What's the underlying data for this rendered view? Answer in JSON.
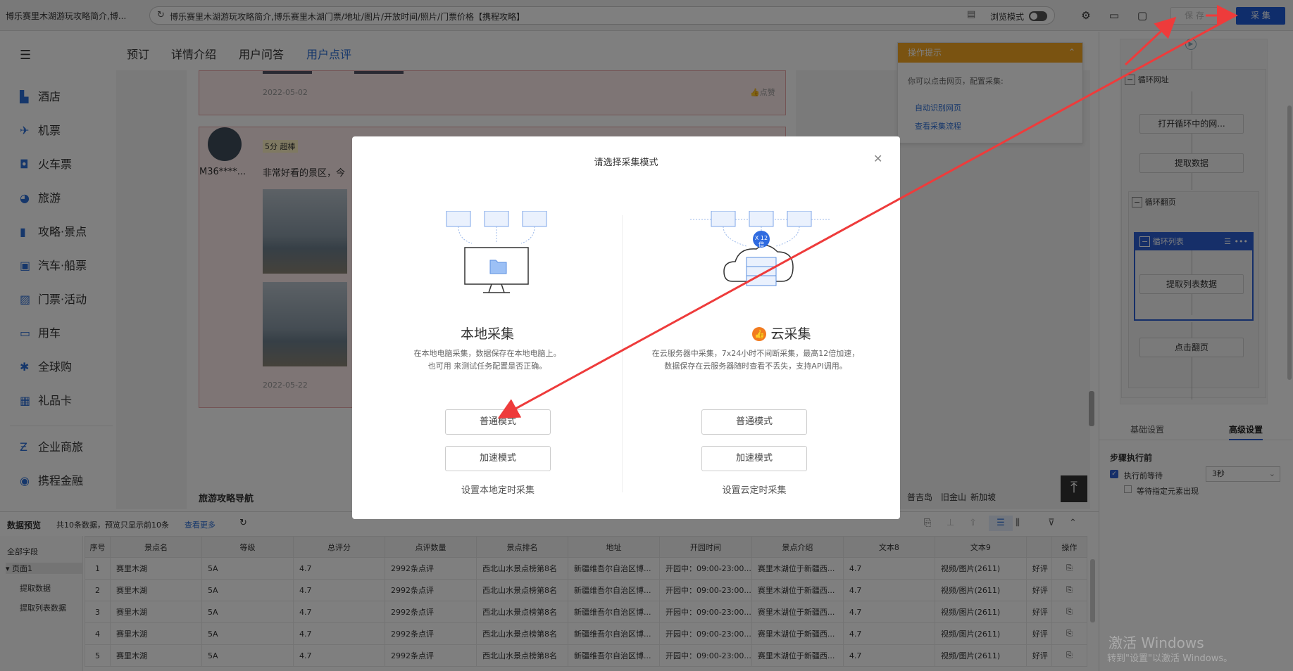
{
  "browser": {
    "tab_title": "博乐赛里木湖游玩攻略简介,博...",
    "url": "博乐赛里木湖游玩攻略简介,博乐赛里木湖门票/地址/图片/开放时间/照片/门票价格【携程攻略】",
    "browse_mode_label": "浏览模式",
    "save_label": "保 存",
    "collect_label": "采 集"
  },
  "site": {
    "nav": [
      "酒店",
      "机票",
      "火车票",
      "旅游",
      "攻略·景点",
      "汽车·船票",
      "门票·活动",
      "用车",
      "全球购",
      "礼品卡",
      "企业商旅",
      "携程金融"
    ],
    "tabs": [
      "预订",
      "详情介绍",
      "用户问答",
      "用户点评"
    ],
    "review1_date": "2022-05-02",
    "like_label": "点赞",
    "review2_user": "M36****...",
    "review2_score": "5分 超棒",
    "review2_text": "非常好看的景区，今",
    "review2_date": "2022-05-22",
    "guide_nav": "旅游攻略导航",
    "guide_links": [
      "普吉岛",
      "旧金山",
      "新加坡"
    ]
  },
  "tips": {
    "title": "操作提示",
    "text": "你可以点击网页，配置采集:",
    "link1": "自动识别网页",
    "link2": "查看采集流程"
  },
  "flow": {
    "loop_url": "循环网址",
    "open_loop": "打开循环中的网...",
    "extract": "提取数据",
    "loop_page": "循环翻页",
    "loop_list": "循环列表",
    "extract_list": "提取列表数据",
    "click_next": "点击翻页"
  },
  "settings": {
    "tab_basic": "基础设置",
    "tab_advanced": "高级设置",
    "section": "步骤执行前",
    "wait_before": "执行前等待",
    "wait_value": "3秒",
    "wait_element": "等待指定元素出现"
  },
  "preview": {
    "title": "数据预览",
    "summary": "共10条数据，预览只显示前10条",
    "more": "查看更多",
    "all_fields": "全部字段",
    "tree": [
      "页面1",
      "提取数据",
      "提取列表数据"
    ],
    "columns": [
      "序号",
      "景点名",
      "等级",
      "总评分",
      "点评数量",
      "景点排名",
      "地址",
      "开园时间",
      "景点介绍",
      "文本8",
      "文本9",
      "",
      "操作"
    ],
    "rows": [
      [
        "1",
        "赛里木湖",
        "5A",
        "4.7",
        "2992条点评",
        "西北山水景点榜第8名",
        "新疆维吾尔自治区博...",
        "开园中：09:00-23:00...",
        "赛里木湖位于新疆西...",
        "4.7",
        "视频/图片(2611)",
        "好评"
      ],
      [
        "2",
        "赛里木湖",
        "5A",
        "4.7",
        "2992条点评",
        "西北山水景点榜第8名",
        "新疆维吾尔自治区博...",
        "开园中：09:00-23:00...",
        "赛里木湖位于新疆西...",
        "4.7",
        "视频/图片(2611)",
        "好评"
      ],
      [
        "3",
        "赛里木湖",
        "5A",
        "4.7",
        "2992条点评",
        "西北山水景点榜第8名",
        "新疆维吾尔自治区博...",
        "开园中：09:00-23:00...",
        "赛里木湖位于新疆西...",
        "4.7",
        "视频/图片(2611)",
        "好评"
      ],
      [
        "4",
        "赛里木湖",
        "5A",
        "4.7",
        "2992条点评",
        "西北山水景点榜第8名",
        "新疆维吾尔自治区博...",
        "开园中：09:00-23:00...",
        "赛里木湖位于新疆西...",
        "4.7",
        "视频/图片(2611)",
        "好评"
      ],
      [
        "5",
        "赛里木湖",
        "5A",
        "4.7",
        "2992条点评",
        "西北山水景点榜第8名",
        "新疆维吾尔自治区博...",
        "开园中：09:00-23:00...",
        "赛里木湖位于新疆西...",
        "4.7",
        "视频/图片(2611)",
        "好评"
      ]
    ]
  },
  "modal": {
    "title": "请选择采集模式",
    "local_title": "本地采集",
    "local_desc1": "在本地电脑采集，数据保存在本地电脑上。",
    "local_desc2": "也可用 来测试任务配置是否正确。",
    "cloud_title": "云采集",
    "cloud_desc1": "在云服务器中采集，7x24小时不间断采集，最高12倍加速，",
    "cloud_desc2": "数据保存在云服务器随时查看不丢失，支持API调用。",
    "normal_mode": "普通模式",
    "fast_mode": "加速模式",
    "local_schedule": "设置本地定时采集",
    "cloud_schedule": "设置云定时采集",
    "speed_badge": "X 12倍"
  },
  "watermark": {
    "line1": "激活 Windows",
    "line2": "转到\"设置\"以激活 Windows。"
  },
  "colors": {
    "accent": "#1f5bd7",
    "arrow": "#ee3b3b",
    "tip": "#f5a623"
  }
}
